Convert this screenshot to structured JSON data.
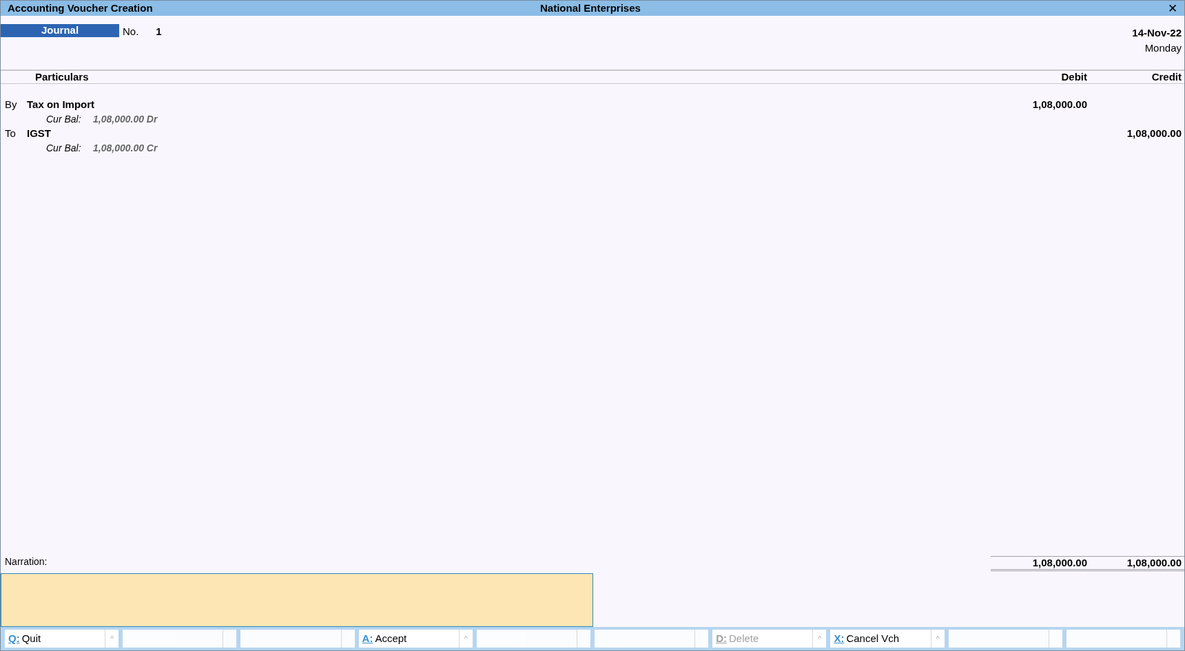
{
  "window": {
    "title": "Accounting Voucher Creation",
    "company": "National Enterprises",
    "close": "✕"
  },
  "voucher": {
    "type": "Journal",
    "number_label": "No.",
    "number": "1",
    "date": "14-Nov-22",
    "day": "Monday"
  },
  "columns": {
    "particulars": "Particulars",
    "debit": "Debit",
    "credit": "Credit"
  },
  "entries": [
    {
      "prefix": "By",
      "ledger": "Tax on Import",
      "debit": "1,08,000.00",
      "balance_label": "Cur Bal:",
      "balance": "1,08,000.00 Dr"
    },
    {
      "prefix": "To",
      "ledger": "IGST",
      "credit": "1,08,000.00",
      "balance_label": "Cur Bal:",
      "balance": "1,08,000.00 Cr"
    }
  ],
  "narration": {
    "label": "Narration:"
  },
  "totals": {
    "debit": "1,08,000.00",
    "credit": "1,08,000.00"
  },
  "buttons": [
    {
      "kind": "action",
      "key": "Q:",
      "label": "Quit",
      "caret": "^",
      "disabled": false
    },
    {
      "kind": "empty"
    },
    {
      "kind": "empty"
    },
    {
      "kind": "action",
      "key": "A:",
      "label": "Accept",
      "caret": "^",
      "disabled": false
    },
    {
      "kind": "empty"
    },
    {
      "kind": "empty"
    },
    {
      "kind": "action",
      "key": "D:",
      "label": "Delete",
      "caret": "^",
      "disabled": true
    },
    {
      "kind": "action",
      "key": "X:",
      "label": "Cancel Vch",
      "caret": "^",
      "disabled": false
    },
    {
      "kind": "empty"
    },
    {
      "kind": "empty"
    }
  ]
}
